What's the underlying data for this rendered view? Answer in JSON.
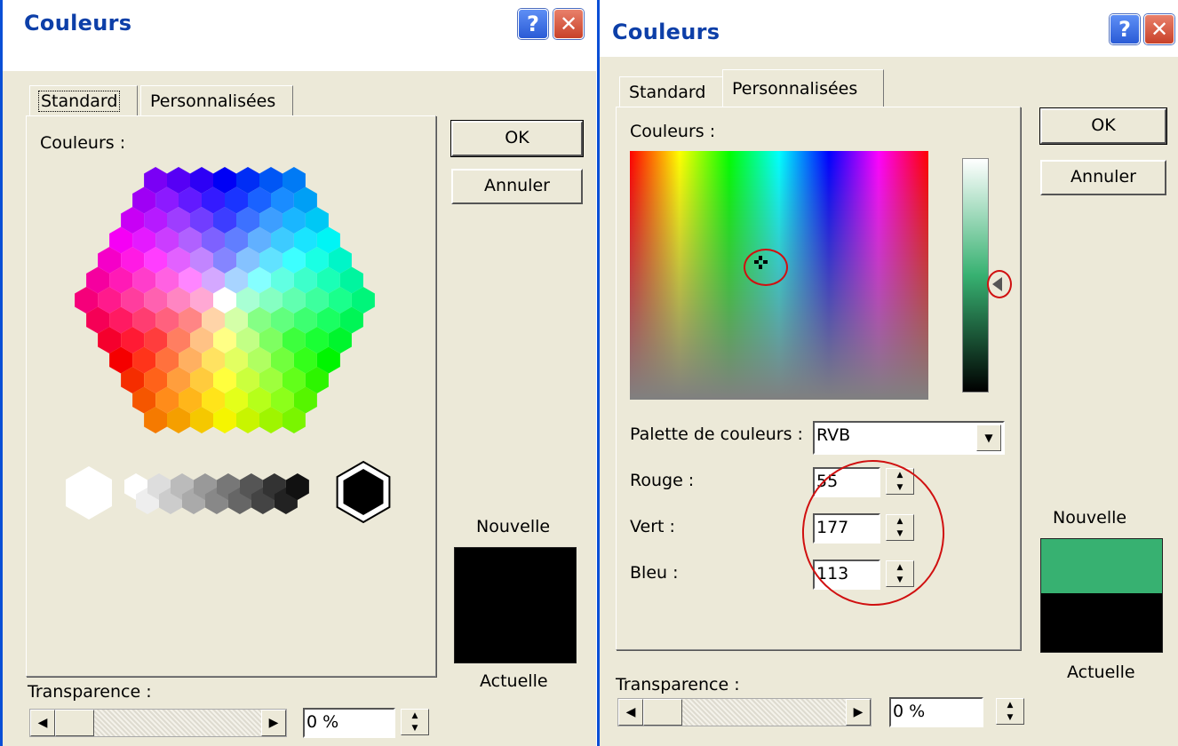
{
  "left_dialog": {
    "title": "Couleurs",
    "help_label": "?",
    "close_label": "✕",
    "tabs": [
      "Standard",
      "Personnalisées"
    ],
    "active_tab": "Standard",
    "colors_label": "Couleurs :",
    "ok_label": "OK",
    "cancel_label": "Annuler",
    "new_label": "Nouvelle",
    "current_label": "Actuelle",
    "new_color": "#000000",
    "current_color": "#000000",
    "transparency_label": "Transparence :",
    "transparency_value": "0 %",
    "selected_gray": "#000000"
  },
  "right_dialog": {
    "title": "Couleurs",
    "help_label": "?",
    "close_label": "✕",
    "tabs": [
      "Standard",
      "Personnalisées"
    ],
    "active_tab": "Personnalisées",
    "colors_label": "Couleurs :",
    "palette_label": "Palette de couleurs :",
    "palette_value": "RVB",
    "red_label": "Rouge :",
    "red_value": "55",
    "green_label": "Vert :",
    "green_value": "177",
    "blue_label": "Bleu :",
    "blue_value": "113",
    "ok_label": "OK",
    "cancel_label": "Annuler",
    "new_label": "Nouvelle",
    "current_label": "Actuelle",
    "new_color": "#37b171",
    "current_color": "#000000",
    "transparency_label": "Transparence :",
    "transparency_value": "0 %"
  }
}
